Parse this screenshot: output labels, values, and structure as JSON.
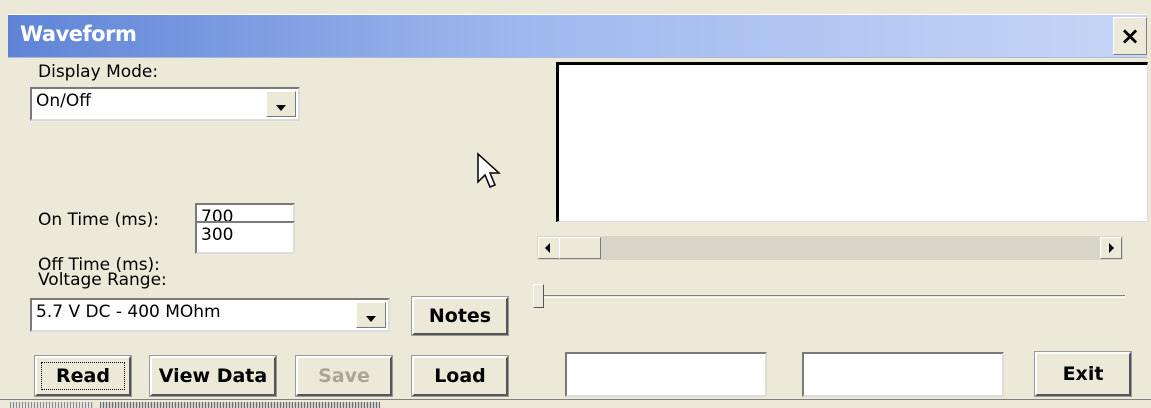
{
  "window": {
    "title": "Waveform",
    "close_label": "×"
  },
  "display_mode": {
    "label": "Display Mode:",
    "value": "On/Off"
  },
  "on_time": {
    "label": "On Time (ms):",
    "value": "700"
  },
  "off_time": {
    "label": "Off Time (ms):",
    "value": "300"
  },
  "voltage_range": {
    "label": "Voltage Range:",
    "value": "5.7 V DC - 400 MOhm"
  },
  "buttons": {
    "notes": "Notes",
    "read": "Read",
    "view_data": "View Data",
    "save": "Save",
    "load": "Load",
    "exit": "Exit"
  },
  "status_fields": [
    "",
    ""
  ],
  "scrollbar": {
    "position": 0.0
  },
  "slider": {
    "position": 0.0
  },
  "colors": {
    "titlebar_start": "#5f84d6",
    "titlebar_end": "#c7d6f7",
    "face": "#ece9d8"
  }
}
